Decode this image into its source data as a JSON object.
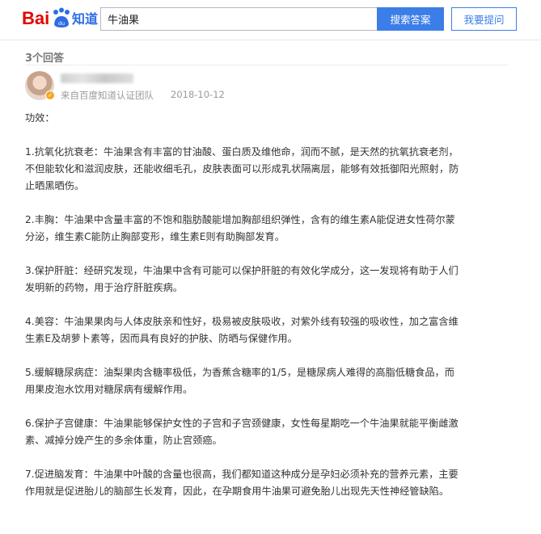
{
  "header": {
    "logo_text": "Bai知道",
    "search_value": "牛油果",
    "search_button": "搜索答案",
    "ask_button": "我要提问"
  },
  "answer_count": "3个回答",
  "answer": {
    "source": "来自百度知道认证团队",
    "date": "2018-10-12",
    "intro": "功效：",
    "paragraphs": [
      {
        "lines": [
          "1.抗氧化抗衰老：牛油果含有丰富的甘油酸、蛋白质及维他命，润而不腻，是天然的抗氧抗衰老剂，",
          "不但能软化和滋润皮肤，还能收细毛孔，皮肤表面可以形成乳状隔离层，能够有效抵御阳光照射，防",
          "止晒黑晒伤。"
        ]
      },
      {
        "lines": [
          "2.丰胸：牛油果中含量丰富的不饱和脂肪酸能增加胸部组织弹性，含有的维生素A能促进女性荷尔蒙",
          "分泌，维生素C能防止胸部变形，维生素E则有助胸部发育。"
        ]
      },
      {
        "lines": [
          "3.保护肝脏：经研究发现，牛油果中含有可能可以保护肝脏的有效化学成分，这一发现将有助于人们",
          "发明新的药物，用于治疗肝脏疾病。"
        ]
      },
      {
        "lines": [
          "4.美容：牛油果果肉与人体皮肤亲和性好，极易被皮肤吸收，对紫外线有较强的吸收性，加之富含维",
          "生素E及胡萝卜素等，因而具有良好的护肤、防晒与保健作用。"
        ]
      },
      {
        "lines": [
          "5.缓解糖尿病症：油梨果肉含糖率极低，为香蕉含糖率的1/5，是糖尿病人难得的高脂低糖食品，而",
          "用果皮泡水饮用对糖尿病有缓解作用。"
        ]
      },
      {
        "lines": [
          "6.保护子宫健康：牛油果能够保护女性的子宫和子宫颈健康，女性每星期吃一个牛油果就能平衡雌激",
          "素、减掉分娩产生的多余体重，防止宫颈癌。"
        ]
      },
      {
        "lines": [
          "7.促进脑发育：牛油果中叶酸的含量也很高，我们都知道这种成分是孕妇必须补充的营养元素，主要",
          "作用就是促进胎儿的脑部生长发育，因此，在孕期食用牛油果可避免胎儿出现先天性神经管缺陷。"
        ]
      }
    ]
  },
  "colors": {
    "brand_red": "#e10602",
    "brand_blue": "#2e6ce6",
    "accent_button": "#3c7ee8"
  },
  "icons": {
    "logo": "baidu-paw-logo",
    "badge": "verified-badge-icon"
  }
}
